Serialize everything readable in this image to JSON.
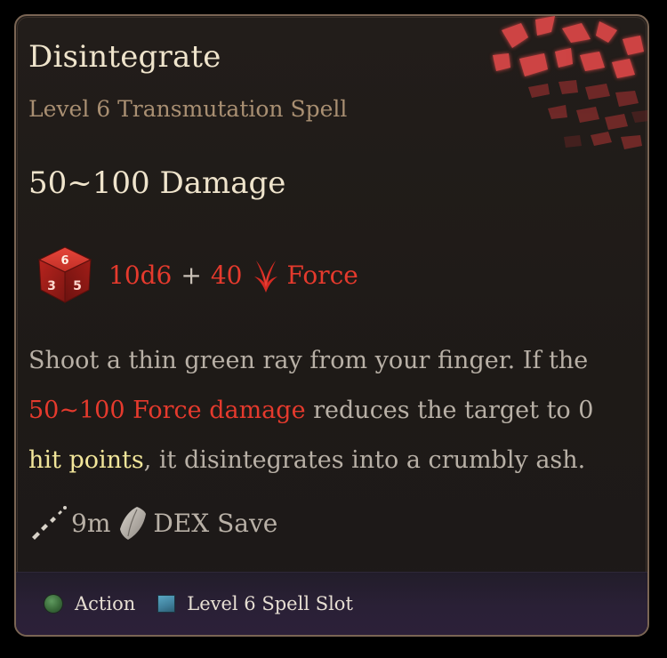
{
  "spell": {
    "name": "Disintegrate",
    "subtitle": "Level 6 Transmutation Spell",
    "damage_heading": "50~100 Damage"
  },
  "damage_roll": {
    "dice": "10d6",
    "plus": "+",
    "bonus": "40",
    "damage_type": "Force",
    "icons": {
      "dice": "d6-dice-icon",
      "damage_type": "force-damage-icon"
    }
  },
  "description": {
    "part1": "Shoot a thin green ray from your finger. If the ",
    "highlight_damage": "50~100 Force damage",
    "part2": " reduces the target to 0 ",
    "highlight_hp": "hit points",
    "part3": ", it disintegrates into a crumbly ash."
  },
  "stats": {
    "range": "9m",
    "save": "DEX Save",
    "icons": {
      "range": "range-icon",
      "save": "shield-icon"
    }
  },
  "footer": {
    "action_label": "Action",
    "slot_label": "Level 6 Spell Slot",
    "icons": {
      "action": "action-circle-icon",
      "slot": "spell-slot-icon"
    }
  },
  "colors": {
    "title": "#efe4cc",
    "subtitle": "#a98f72",
    "damage_red": "#e53a2d",
    "highlight_yellow": "#f2e69a",
    "body_text": "#b8b0a6",
    "border": "#7a6554",
    "footer_bg": "#2a2036",
    "action_green": "#3a6b3a",
    "slot_blue": "#3f7f9b"
  }
}
